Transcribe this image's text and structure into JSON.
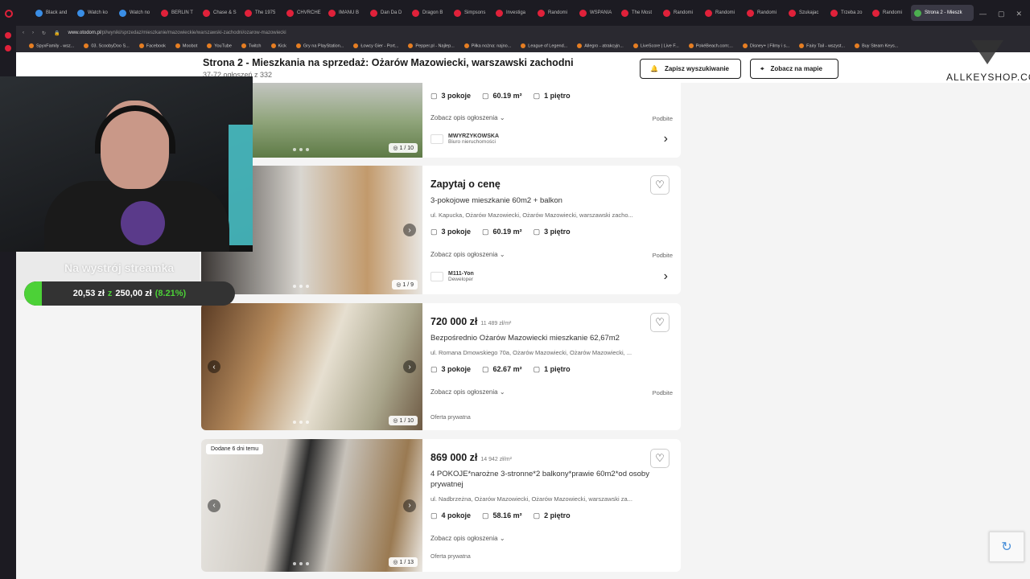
{
  "browser": {
    "tabs": [
      "Black and",
      "Watch ko",
      "Watch no",
      "BERLIN T",
      "Chase & S",
      "The 1975",
      "CHVRCHE",
      "IMANU B",
      "Dan Da D",
      "Dragon B",
      "Simpsons",
      "Investiga",
      "Randomi",
      "WSPANIA",
      "The Most",
      "Randomi",
      "Randomi",
      "Randomi",
      "Szukajac",
      "Trzeba zo",
      "Randomi"
    ],
    "active_tab": "Strona 2 - Mieszk",
    "url_domain": "www.otodom.pl",
    "url_path": "/pl/wyniki/sprzedaz/mieszkanie/mazowieckie/warszawski-zachodni/ozarow-mazowiecki",
    "bookmarks": [
      "SpyxFamily - wsz...",
      "03. ScoobyDoo S...",
      "Facebook",
      "Moobot",
      "YouTube",
      "Twitch",
      "Kick",
      "Gry na PlayStation...",
      "Łowcy Gier - Port...",
      "Pepper.pl - Najlep...",
      "Piłka nożna: najno...",
      "League of Legend...",
      "Allegro - atrakcyjn...",
      "LiveScore | Live F...",
      "PokéBeach.com:...",
      "Disney+ | Filmy i s...",
      "Fairy Tail - wszyst...",
      "Buy Steam Keys..."
    ]
  },
  "header": {
    "title": "Strona 2 - Mieszkania na sprzedaż: Ożarów Mazowiecki, warszawski zachodni",
    "subtitle": "37-72 ogłoszeń z 332",
    "save_search": "Zapisz wyszukiwanie",
    "show_map": "Zobacz na mapie"
  },
  "listings": [
    {
      "features": [
        "3 pokoje",
        "60.19 m²",
        "1 piętro"
      ],
      "desc_link": "Zobacz opis ogłoszenia",
      "promoted": "Podbite",
      "agency_name": "MWYRZYKOWSKA",
      "agency_type": "Biuro nieruchomości",
      "photo_count": "1 / 10"
    },
    {
      "price": "Zapytaj o cenę",
      "title": "3-pokojowe mieszkanie 60m2 + balkon",
      "address": "ul. Kapucka, Ożarów Mazowiecki, Ożarów Mazowiecki, warszawski zacho...",
      "features": [
        "3 pokoje",
        "60.19 m²",
        "3 piętro"
      ],
      "desc_link": "Zobacz opis ogłoszenia",
      "promoted": "Podbite",
      "agency_name": "M111-Yon",
      "agency_type": "Deweloper",
      "photo_count": "1 / 9"
    },
    {
      "price": "720 000 zł",
      "price_per_m2": "11 489 zł/m²",
      "title": "Bezpośrednio Ożarów Mazowiecki mieszkanie 62,67m2",
      "address": "ul. Romana Dmowskiego 70a, Ożarów Mazowiecki, Ożarów Mazowiecki, ...",
      "features": [
        "3 pokoje",
        "62.67 m²",
        "1 piętro"
      ],
      "desc_link": "Zobacz opis ogłoszenia",
      "promoted": "Podbite",
      "seller": "Oferta prywatna",
      "photo_count": "1 / 10"
    },
    {
      "badge": "Dodane 6 dni temu",
      "price": "869 000 zł",
      "price_per_m2": "14 942 zł/m²",
      "title": "4 POKOJE*narożne 3-stronne*2 balkony*prawie 60m2*od osoby prywatnej",
      "address": "ul. Nadbrzeżna, Ożarów Mazowiecki, Ożarów Mazowiecki, warszawski za...",
      "features": [
        "4 pokoje",
        "58.16 m²",
        "2 piętro"
      ],
      "desc_link": "Zobacz opis ogłoszenia",
      "seller": "Oferta prywatna",
      "photo_count": "1 / 13"
    }
  ],
  "overlay": {
    "donation_title": "Na wystrój streamka",
    "donation_current": "20,53 zł",
    "donation_separator": "z",
    "donation_goal": "250,00 zł",
    "donation_percent": "(8.21%)",
    "donation_progress": 0.0821,
    "sponsor": "ALLKEYSHOP.CO"
  },
  "colors": {
    "brand_green": "#4cd137",
    "opera_red": "#e0213a"
  }
}
